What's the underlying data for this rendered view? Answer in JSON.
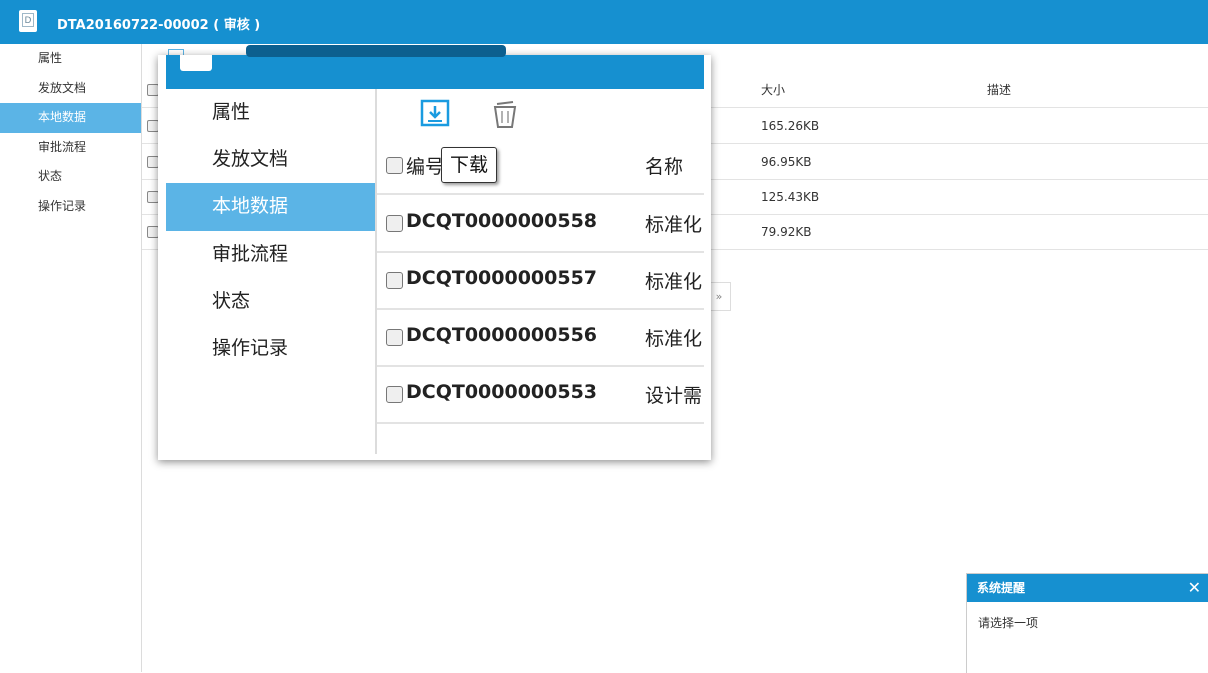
{
  "header": {
    "app_icon_glyph": "D",
    "title": "DTA20160722-00002 ( 审核 )"
  },
  "sidebar": {
    "items": [
      {
        "label": "属性",
        "active": false
      },
      {
        "label": "发放文档",
        "active": false
      },
      {
        "label": "本地数据",
        "active": true
      },
      {
        "label": "审批流程",
        "active": false
      },
      {
        "label": "状态",
        "active": false
      },
      {
        "label": "操作记录",
        "active": false
      }
    ]
  },
  "table": {
    "columns": {
      "size": "大小",
      "description": "描述"
    },
    "rows": [
      {
        "size": "165.26KB",
        "description": ""
      },
      {
        "size": "96.95KB",
        "description": ""
      },
      {
        "size": "125.43KB",
        "description": ""
      },
      {
        "size": "79.92KB",
        "description": ""
      }
    ],
    "pager_next": "»"
  },
  "zoom": {
    "sidebar_items": [
      {
        "label": "属性",
        "active": false
      },
      {
        "label": "发放文档",
        "active": false
      },
      {
        "label": "本地数据",
        "active": true
      },
      {
        "label": "审批流程",
        "active": false
      },
      {
        "label": "状态",
        "active": false
      },
      {
        "label": "操作记录",
        "active": false
      }
    ],
    "toolbar": {
      "download_icon": "download-icon",
      "delete_icon": "trash-icon"
    },
    "columns": {
      "code": "编号",
      "name": "名称"
    },
    "rows": [
      {
        "code": "DCQT0000000558",
        "name": "标准化"
      },
      {
        "code": "DCQT0000000557",
        "name": "标准化"
      },
      {
        "code": "DCQT0000000556",
        "name": "标准化"
      },
      {
        "code": "DCQT0000000553",
        "name": "设计需"
      }
    ],
    "tooltip": "下载"
  },
  "notice": {
    "title": "系统提醒",
    "close_glyph": "✕",
    "message": "请选择一项"
  },
  "colors": {
    "header_blue": "#1690d0",
    "active_item": "#5bb4e6",
    "accent": "#1a9be0"
  }
}
